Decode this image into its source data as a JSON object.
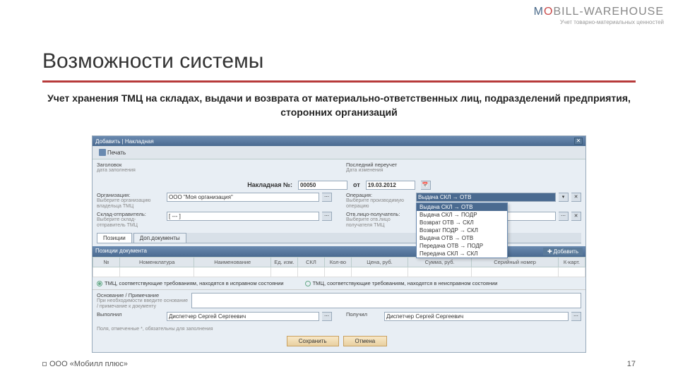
{
  "logo": {
    "m": "M",
    "o": "O",
    "rest": "BILL-WAREHOUSE",
    "sub": "Учет товарно-материальных ценностей"
  },
  "title": "Возможности системы",
  "subtitle": "Учет хранения ТМЦ на складах, выдачи и возврата от материально-ответственных лиц, подразделений предприятия, сторонних организаций",
  "app": {
    "header": "Добавить | Накладная",
    "toolbar": {
      "print": "Печать"
    },
    "top": {
      "l1": "Заголовок",
      "l1s": "дата заполнения",
      "r1": "Последний переучет",
      "r1s": "Дата изменения"
    },
    "docnum": {
      "label": "Накладная №:",
      "val": "00050",
      "from": "от",
      "date": "19.03.2012"
    },
    "form": {
      "org_l": "Организация:",
      "org_s": "Выберите организацию владельца ТМЦ",
      "org_v": "ООО \"Моя организация\"",
      "op_l": "Операция:",
      "op_s": "Выберите производимую операцию",
      "op_v": "Выдача СКЛ → ОТВ",
      "skl_l": "Склад-отправитель:",
      "skl_s": "Выберите склад-отправитель ТМЦ",
      "skl_v": "[ --- ]",
      "otv_l": "Отв.лицо-получатель:",
      "otv_s": "Выберите отв.лицо получателя ТМЦ"
    },
    "dropdown": [
      "Выдача СКЛ → ОТВ",
      "Выдача СКЛ → ПОДР",
      "Возврат ОТВ → СКЛ",
      "Возврат ПОДР → СКЛ",
      "Выдача ОТВ → ОТВ",
      "Передача ОТВ → ПОДР",
      "Передача СКЛ → СКЛ"
    ],
    "tabs": [
      "Позиции",
      "Доп.документы"
    ],
    "positions": {
      "title": "Позиции документа",
      "add": "Добавить",
      "cols": [
        "№",
        "Номенклатура",
        "Наименование",
        "Ед. изм.",
        "СКЛ",
        "Кол-во",
        "Цена, руб.",
        "Сумма, руб.",
        "Серийный номер",
        "К-карт."
      ]
    },
    "radios": {
      "r1": "ТМЦ, соответствующие требованиям, находятся в исправном состоянии",
      "r2": "ТМЦ, соответствующие требованиям, находятся в неисправном состоянии"
    },
    "bottom": {
      "osn_l": "Основание / Примечание",
      "osn_s": "При необходимости введите основание / примечание к документу",
      "vyp": "Выполнил",
      "vyp_v": "Диспетчер Сергей Сергеевич",
      "pol": "Получил",
      "pol_v": "Диспетчер Сергей Сергеевич",
      "note": "Поля, отмеченные *, обязательны для заполнения",
      "save": "Сохранить",
      "cancel": "Отмена"
    }
  },
  "footer": {
    "left": "ООО «Мобилл плюс»",
    "right": "17"
  }
}
